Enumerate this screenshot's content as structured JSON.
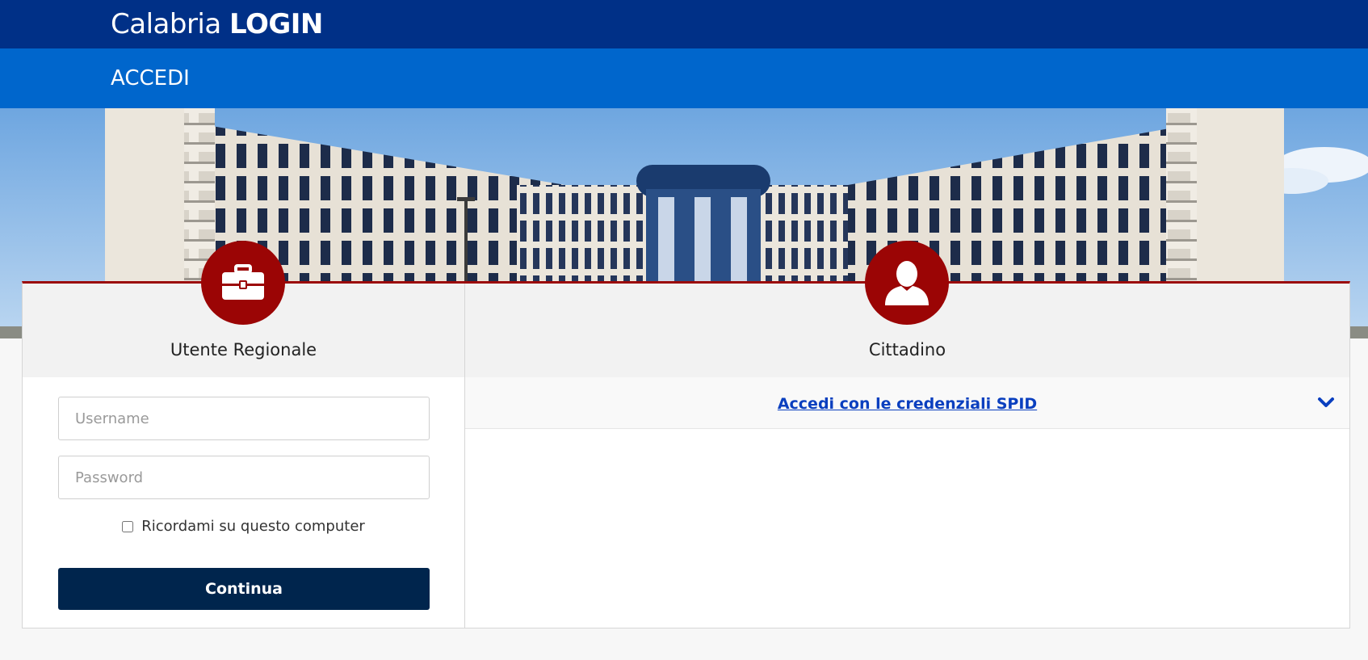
{
  "header": {
    "brand_light": "Calabria",
    "brand_bold": "LOGIN",
    "section_title": "ACCEDI",
    "colors": {
      "top_bar": "#003087",
      "sub_bar": "#0066cc",
      "accent_red": "#9b0505"
    }
  },
  "hero": {
    "image": "regional-headquarters-building-photo"
  },
  "left_panel": {
    "icon": "briefcase-icon",
    "title": "Utente Regionale",
    "username_placeholder": "Username",
    "username_value": "",
    "password_placeholder": "Password",
    "password_value": "",
    "remember_label": "Ricordami su questo computer",
    "remember_checked": false,
    "submit_label": "Continua"
  },
  "right_panel": {
    "icon": "user-icon",
    "title": "Cittadino",
    "spid_link_label": "Accedi con le credenziali SPID",
    "spid_toggle_icon": "chevron-down-icon"
  }
}
